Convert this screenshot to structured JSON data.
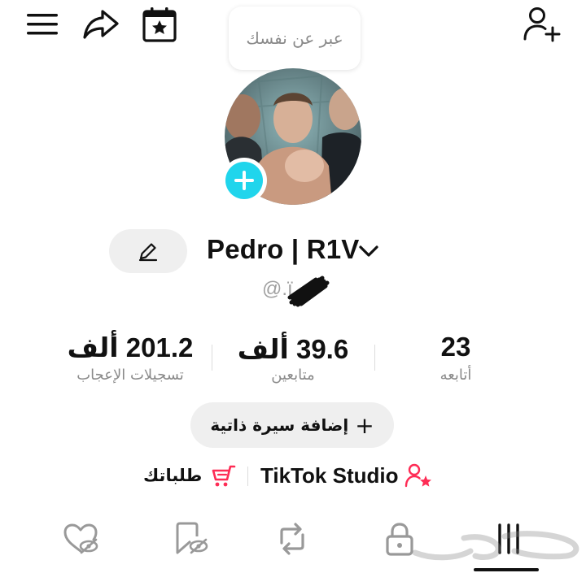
{
  "header": {
    "menu_icon": "hamburger-icon",
    "share_icon": "share-arrow-icon",
    "calendar_icon": "calendar-star-icon",
    "add_friend_icon": "add-user-icon"
  },
  "bubble": {
    "text": "عبر عن نفسك"
  },
  "profile": {
    "display_name": "Pedro | R1V",
    "username_prefix": "@.ï",
    "edit_icon": "pencil-icon",
    "avatar_add_icon": "plus-icon"
  },
  "stats": {
    "likes": {
      "value": "201.2 ألف",
      "label": "تسجيلات الإعجاب"
    },
    "followers": {
      "value": "39.6 ألف",
      "label": "متابعين"
    },
    "following": {
      "value": "23",
      "label": "أتابعه"
    }
  },
  "bio_button": {
    "label": "إضافة سيرة ذاتية",
    "icon": "plus-icon"
  },
  "links": {
    "orders": {
      "label": "طلباتك",
      "icon": "cart-icon"
    },
    "studio": {
      "label": "TikTok Studio",
      "icon": "user-star-icon"
    }
  },
  "tabs": [
    {
      "name": "liked",
      "icon": "heart-hidden-icon"
    },
    {
      "name": "saved",
      "icon": "bookmark-hidden-icon"
    },
    {
      "name": "reposts",
      "icon": "repost-icon"
    },
    {
      "name": "private",
      "icon": "lock-icon"
    },
    {
      "name": "videos",
      "icon": "grid-icon",
      "active": true
    }
  ],
  "colors": {
    "accent_cyan": "#20d5ec",
    "accent_pink": "#fe2c55",
    "muted_text": "#8a8a8a"
  }
}
